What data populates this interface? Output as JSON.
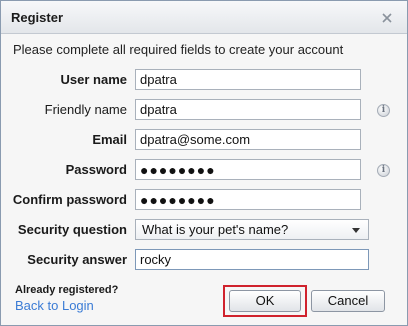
{
  "dialog": {
    "title": "Register",
    "close_icon": "close-icon",
    "intro": "Please complete all required fields to create your account"
  },
  "fields": {
    "user_name": {
      "label": "User name",
      "value": "dpatra"
    },
    "friendly_name": {
      "label": "Friendly name",
      "value": "dpatra",
      "info_icon": "info-icon"
    },
    "email": {
      "label": "Email",
      "value": "dpatra@some.com"
    },
    "password": {
      "label": "Password",
      "value": "●●●●●●●●",
      "info_icon": "info-icon"
    },
    "confirm_password": {
      "label": "Confirm password",
      "value": "●●●●●●●●"
    },
    "security_question": {
      "label": "Security question",
      "value": "What is your pet's name?"
    },
    "security_answer": {
      "label": "Security answer",
      "value": "rocky"
    }
  },
  "footer": {
    "already_registered": "Already registered?",
    "back_to_login": "Back to Login",
    "ok_label": "OK",
    "cancel_label": "Cancel"
  },
  "colors": {
    "highlight": "#d0222d",
    "link": "#3a7bd5"
  }
}
